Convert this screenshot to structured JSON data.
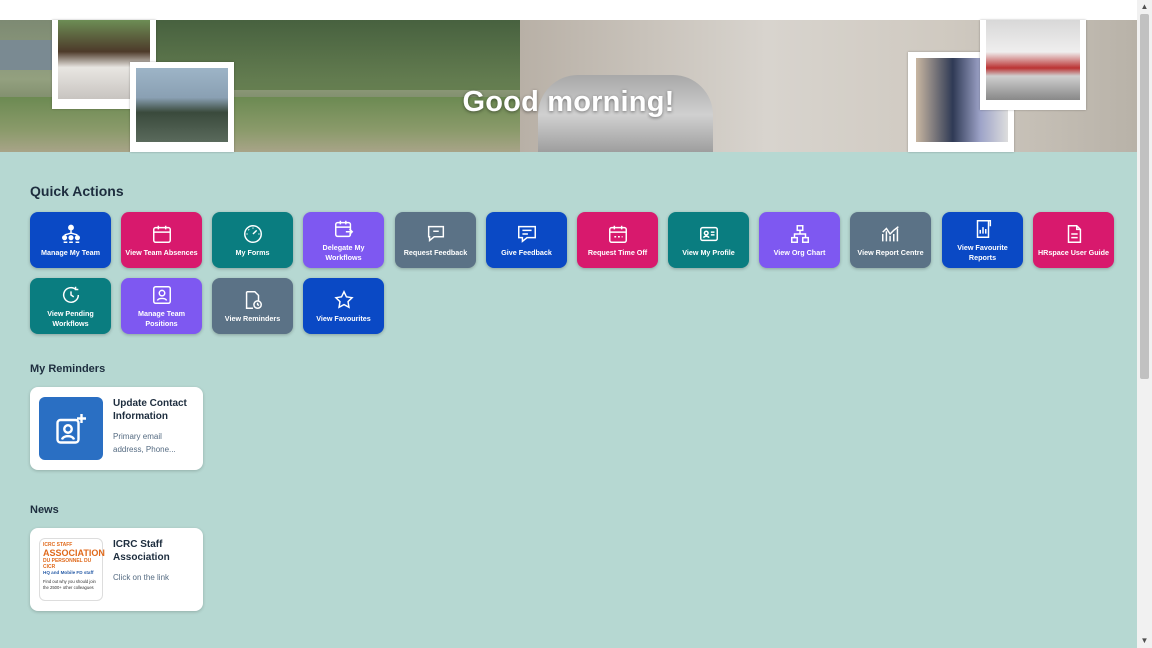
{
  "header": {
    "greeting": "Good morning!"
  },
  "quick_actions": {
    "title": "Quick Actions",
    "items": [
      {
        "label": "Manage My Team",
        "icon": "team-icon",
        "color": "#0a49c5"
      },
      {
        "label": "View Team Absences",
        "icon": "calendar-icon",
        "color": "#d8196d"
      },
      {
        "label": "My Forms",
        "icon": "gauge-icon",
        "color": "#0a7d80"
      },
      {
        "label": "Delegate My Workflows",
        "icon": "calendar-delegate-icon",
        "color": "#7e58f1"
      },
      {
        "label": "Request Feedback",
        "icon": "feedback-request-icon",
        "color": "#5b7286"
      },
      {
        "label": "Give Feedback",
        "icon": "feedback-give-icon",
        "color": "#0a49c5"
      },
      {
        "label": "Request Time Off",
        "icon": "calendar-timeoff-icon",
        "color": "#d8196d"
      },
      {
        "label": "View My Profile",
        "icon": "profile-card-icon",
        "color": "#0a7d80"
      },
      {
        "label": "View Org Chart",
        "icon": "org-chart-icon",
        "color": "#7e58f1"
      },
      {
        "label": "View Report Centre",
        "icon": "line-chart-icon",
        "color": "#5b7286"
      },
      {
        "label": "View Favourite Reports",
        "icon": "favourite-report-icon",
        "color": "#0a49c5"
      },
      {
        "label": "HRspace User Guide",
        "icon": "document-icon",
        "color": "#d8196d"
      },
      {
        "label": "View Pending Workflows",
        "icon": "pending-workflow-icon",
        "color": "#0a7d80"
      },
      {
        "label": "Manage Team Positions",
        "icon": "position-icon",
        "color": "#7e58f1"
      },
      {
        "label": "View Reminders",
        "icon": "reminder-icon",
        "color": "#5b7286"
      },
      {
        "label": "View Favourites",
        "icon": "star-icon",
        "color": "#0a49c5"
      }
    ]
  },
  "reminders": {
    "title": "My Reminders",
    "cards": [
      {
        "title": "Update Contact Information",
        "subtitle": "Primary email address, Phone...",
        "icon": "add-contact-icon"
      }
    ]
  },
  "news": {
    "title": "News",
    "cards": [
      {
        "title": "ICRC Staff Association",
        "subtitle": "Click on the link",
        "logo": {
          "line1": "ICRC STAFF",
          "line2": "ASSOCIATION",
          "line3": "DU PERSONNEL DU CICR",
          "line4": "HQ and Mobile FD staff",
          "line5": "Find out why you should join the 2500+ other colleagues"
        }
      }
    ]
  }
}
